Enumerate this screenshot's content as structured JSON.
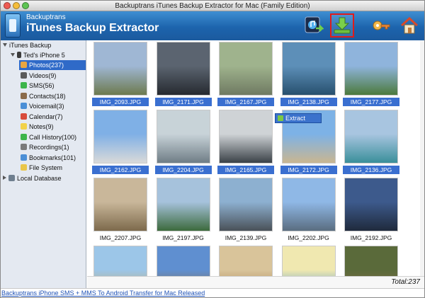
{
  "window": {
    "title": "Backuptrans iTunes Backup Extractor for Mac (Family Edition)"
  },
  "brand": {
    "small": "Backuptrans",
    "big": "iTunes Backup Extractor"
  },
  "toolbar": {
    "buttons": [
      {
        "name": "import-itunes-button",
        "icon": "itunes-transfer-icon"
      },
      {
        "name": "extract-button",
        "icon": "download-arrow-icon",
        "selected": true
      },
      {
        "name": "register-button",
        "icon": "key-icon"
      },
      {
        "name": "home-button",
        "icon": "home-icon"
      }
    ]
  },
  "sidebar": {
    "root": "iTunes Backup",
    "device": "Ted's iPhone 5",
    "items": [
      {
        "label": "Photos(237)",
        "icon": "photos-icon",
        "color": "#e9a640",
        "selected": true
      },
      {
        "label": "Videos(9)",
        "icon": "videos-icon",
        "color": "#5a5a5a"
      },
      {
        "label": "SMS(56)",
        "icon": "sms-icon",
        "color": "#3cb54a"
      },
      {
        "label": "Contacts(18)",
        "icon": "contacts-icon",
        "color": "#8b6b4a"
      },
      {
        "label": "Voicemail(3)",
        "icon": "voicemail-icon",
        "color": "#4b8fd6"
      },
      {
        "label": "Calendar(7)",
        "icon": "calendar-icon",
        "color": "#d84a3a"
      },
      {
        "label": "Notes(9)",
        "icon": "notes-icon",
        "color": "#f2d24a"
      },
      {
        "label": "Call History(100)",
        "icon": "call-history-icon",
        "color": "#3cb54a"
      },
      {
        "label": "Recordings(1)",
        "icon": "recordings-icon",
        "color": "#7a7a7a"
      },
      {
        "label": "Bookmarks(101)",
        "icon": "bookmarks-icon",
        "color": "#4b8fd6"
      },
      {
        "label": "File System",
        "icon": "folder-icon",
        "color": "#e9c64a"
      }
    ],
    "local": "Local Database"
  },
  "context": {
    "extract_label": "Extract"
  },
  "photos": [
    {
      "caption": "IMG_2093.JPG",
      "selected": true,
      "c1": "#9fb7d4",
      "c2": "#6d7a4e"
    },
    {
      "caption": "IMG_2171.JPG",
      "selected": true,
      "c1": "#5b6470",
      "c2": "#262a30"
    },
    {
      "caption": "IMG_2167.JPG",
      "selected": true,
      "c1": "#9fb38d",
      "c2": "#6f7a62"
    },
    {
      "caption": "IMG_2138.JPG",
      "selected": true,
      "c1": "#5d8fb8",
      "c2": "#27506e"
    },
    {
      "caption": "IMG_2177.JPG",
      "selected": true,
      "c1": "#8fb4dc",
      "c2": "#4c7a3d"
    },
    {
      "caption": "IMG_2162.JPG",
      "selected": true,
      "c1": "#7fb0e6",
      "c2": "#d9d9d9"
    },
    {
      "caption": "IMG_2204.JPG",
      "selected": true,
      "c1": "#c8d3d8",
      "c2": "#6f7d86"
    },
    {
      "caption": "IMG_2165.JPG",
      "selected": true,
      "c1": "#cfd3d6",
      "c2": "#3a4147"
    },
    {
      "caption": "IMG_2172.JPG",
      "selected": true,
      "c1": "#7db2e6",
      "c2": "#c9b691"
    },
    {
      "caption": "IMG_2136.JPG",
      "selected": true,
      "c1": "#a8c5e0",
      "c2": "#3a8f9a"
    },
    {
      "caption": "IMG_2207.JPG",
      "selected": false,
      "c1": "#c9b79a",
      "c2": "#7d6a4c"
    },
    {
      "caption": "IMG_2197.JPG",
      "selected": false,
      "c1": "#a6c2dc",
      "c2": "#3c6a3c"
    },
    {
      "caption": "IMG_2139.JPG",
      "selected": false,
      "c1": "#8db0d0",
      "c2": "#4a5158"
    },
    {
      "caption": "IMG_2202.JPG",
      "selected": false,
      "c1": "#8fb8e6",
      "c2": "#5a6d80"
    },
    {
      "caption": "IMG_2192.JPG",
      "selected": false,
      "c1": "#3d5a8c",
      "c2": "#1f2a3c"
    },
    {
      "caption": "",
      "selected": false,
      "c1": "#9cc6e8",
      "c2": "#c9a55a"
    },
    {
      "caption": "",
      "selected": false,
      "c1": "#5f8fd0",
      "c2": "#8a6a3a"
    },
    {
      "caption": "",
      "selected": false,
      "c1": "#d9c49a",
      "c2": "#a07a4a"
    },
    {
      "caption": "",
      "selected": false,
      "c1": "#f0e8b0",
      "c2": "#3b8fd0"
    },
    {
      "caption": "",
      "selected": false,
      "c1": "#5a6a3a",
      "c2": "#8a6a4a"
    }
  ],
  "status": {
    "total": "Total:237"
  },
  "footer": {
    "link": "Backuptrans iPhone SMS + MMS To Android Transfer for Mac Released"
  }
}
